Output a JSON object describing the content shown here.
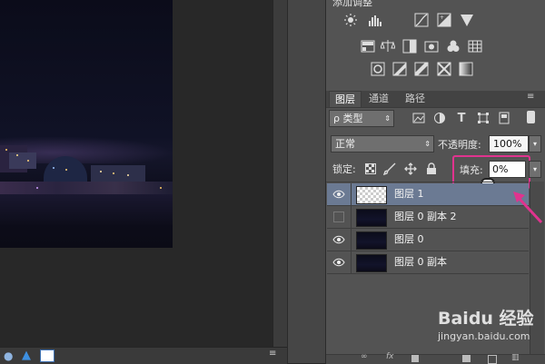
{
  "adjustments": {
    "title": "添加调整",
    "rows": [
      [
        "brightness-icon",
        "levels-icon",
        "curves-icon",
        "exposure-icon",
        "vibrance-icon"
      ],
      [
        "hue-saturation-icon",
        "color-balance-icon",
        "black-white-icon",
        "photo-filter-icon",
        "channel-mixer-icon",
        "color-lookup-icon"
      ],
      [
        "invert-icon",
        "posterize-icon",
        "threshold-icon",
        "selective-color-icon",
        "gradient-map-icon"
      ]
    ]
  },
  "tabs": [
    {
      "label": "图层",
      "active": true
    },
    {
      "label": "通道",
      "active": false
    },
    {
      "label": "路径",
      "active": false
    }
  ],
  "filter": {
    "label": "ρ 类型"
  },
  "blend": {
    "mode": "正常",
    "opacity_label": "不透明度:",
    "opacity_value": "100%"
  },
  "lock": {
    "label": "锁定:"
  },
  "fill": {
    "label": "填充:",
    "value": "0%"
  },
  "layers": [
    {
      "name": "图层 1",
      "visible": true,
      "selected": true,
      "transparent": true
    },
    {
      "name": "图层 0 副本 2",
      "visible": false,
      "selected": false,
      "transparent": false
    },
    {
      "name": "图层 0",
      "visible": true,
      "selected": false,
      "transparent": false
    },
    {
      "name": "图层 0 副本",
      "visible": true,
      "selected": false,
      "transparent": false
    }
  ],
  "colors": {
    "highlight": "#e0338e",
    "selected_row": "#6b7a93",
    "panel": "#535353"
  },
  "watermark": {
    "brand": "Baidu 经验",
    "url": "jingyan.baidu.com"
  }
}
